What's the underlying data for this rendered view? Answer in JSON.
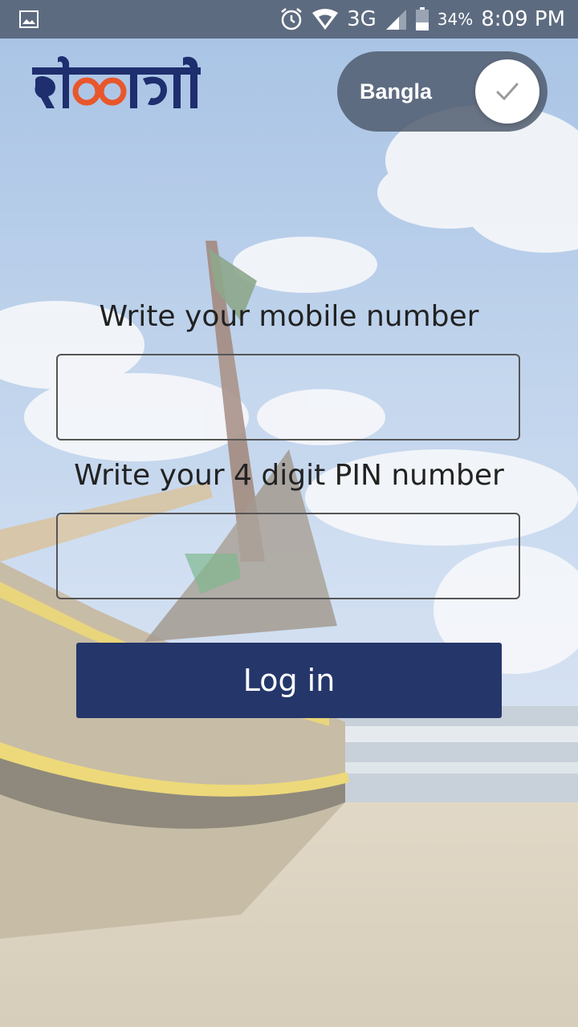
{
  "status_bar": {
    "battery_percent": "34%",
    "network": "3G",
    "time": "8:09 PM",
    "icons": [
      "image-icon",
      "alarm-icon",
      "wifi-icon",
      "signal-icon",
      "battery-icon"
    ]
  },
  "brand": {
    "logo_text": "দিশারী",
    "logo_color": "#1e2e6e",
    "accent_color": "#e8572b"
  },
  "language_toggle": {
    "label": "Bangla",
    "checked": true
  },
  "form": {
    "mobile_label": "Write your mobile number",
    "mobile_value": "",
    "pin_label": "Write your 4 digit PIN number",
    "pin_value": "",
    "login_label": "Log in",
    "button_color": "#25366a"
  }
}
